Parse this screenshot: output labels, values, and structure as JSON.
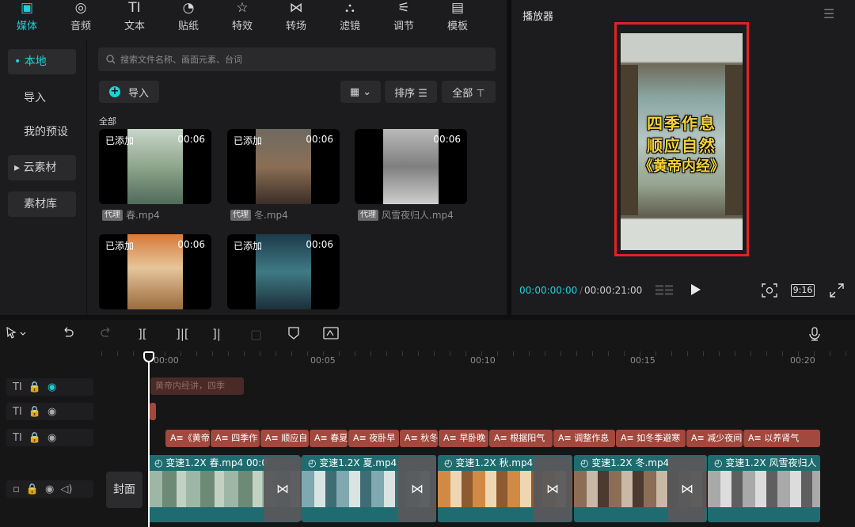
{
  "top_tabs": [
    {
      "icon": "▣",
      "label": "媒体",
      "active": true
    },
    {
      "icon": "◎",
      "label": "音频"
    },
    {
      "icon": "TI",
      "label": "文本"
    },
    {
      "icon": "◔",
      "label": "贴纸"
    },
    {
      "icon": "☆",
      "label": "特效"
    },
    {
      "icon": "⋈",
      "label": "转场"
    },
    {
      "icon": "⛬",
      "label": "滤镜"
    },
    {
      "icon": "⚟",
      "label": "调节"
    },
    {
      "icon": "▤",
      "label": "模板"
    }
  ],
  "sidebar": {
    "items": [
      {
        "label": "• 本地"
      },
      {
        "label": "导入"
      },
      {
        "label": "我的预设"
      },
      {
        "label": "▸ 云素材"
      },
      {
        "label": "素材库"
      }
    ]
  },
  "search": {
    "placeholder": "搜索文件名称、画面元素、台词"
  },
  "toolbar": {
    "import_label": "导入",
    "view_label": "▦ ⌄",
    "sort_label": "排序 ☰",
    "all_label": "全部 ⊤"
  },
  "section_label": "全部",
  "media": [
    {
      "added": "已添加",
      "duration": "00:06",
      "proxy": "代理",
      "name": "春.mp4"
    },
    {
      "added": "已添加",
      "duration": "00:06",
      "proxy": "代理",
      "name": "冬.mp4"
    },
    {
      "added": "",
      "duration": "00:06",
      "proxy": "代理",
      "name": "风雪夜归人.mp4"
    },
    {
      "added": "已添加",
      "duration": "00:06",
      "proxy": "",
      "name": ""
    },
    {
      "added": "已添加",
      "duration": "00:06",
      "proxy": "",
      "name": ""
    }
  ],
  "player": {
    "title": "播放器",
    "overlay_lines": [
      "四季作息",
      "顺应自然",
      "《黄帝内经》"
    ],
    "time_current": "00:00:00:00",
    "time_total": "00:00:21:00",
    "ratio_label": "9:16"
  },
  "timeline": {
    "ruler_labels": [
      "00:00",
      "00:05",
      "00:10",
      "00:15",
      "00:20"
    ],
    "cover_label": "封面",
    "text_track_1": [
      {
        "label": "黄帝内经讲，四季"
      }
    ],
    "subtitles": [
      "A≡《黄帝",
      "A≡ 四季作",
      "A≡ 顺应自",
      "A≡ 春夏",
      "A≡ 夜卧早",
      "A≡ 秋冬",
      "A≡ 早卧晚",
      "A≡ 根据阳气",
      "A≡ 调整作息",
      "A≡ 如冬季避寒",
      "A≡ 减少夜间",
      "A≡ 以养肾气"
    ],
    "video_clips": [
      {
        "speed": "变速1.2X",
        "name": "春.mp4",
        "time": "00:0"
      },
      {
        "speed": "变速1.2X",
        "name": "夏.mp4",
        "time": ""
      },
      {
        "speed": "变速1.2X",
        "name": "秋.mp4",
        "time": ""
      },
      {
        "speed": "变速1.2X",
        "name": "冬.mp4",
        "time": ""
      },
      {
        "speed": "变速1.2X",
        "name": "风雪夜归人",
        "time": ""
      }
    ]
  },
  "colors": {
    "accent": "#1fd0d7",
    "highlight_box": "#e02323",
    "subtitle_clip": "#a3483d",
    "video_clip": "#1e6c6f"
  }
}
